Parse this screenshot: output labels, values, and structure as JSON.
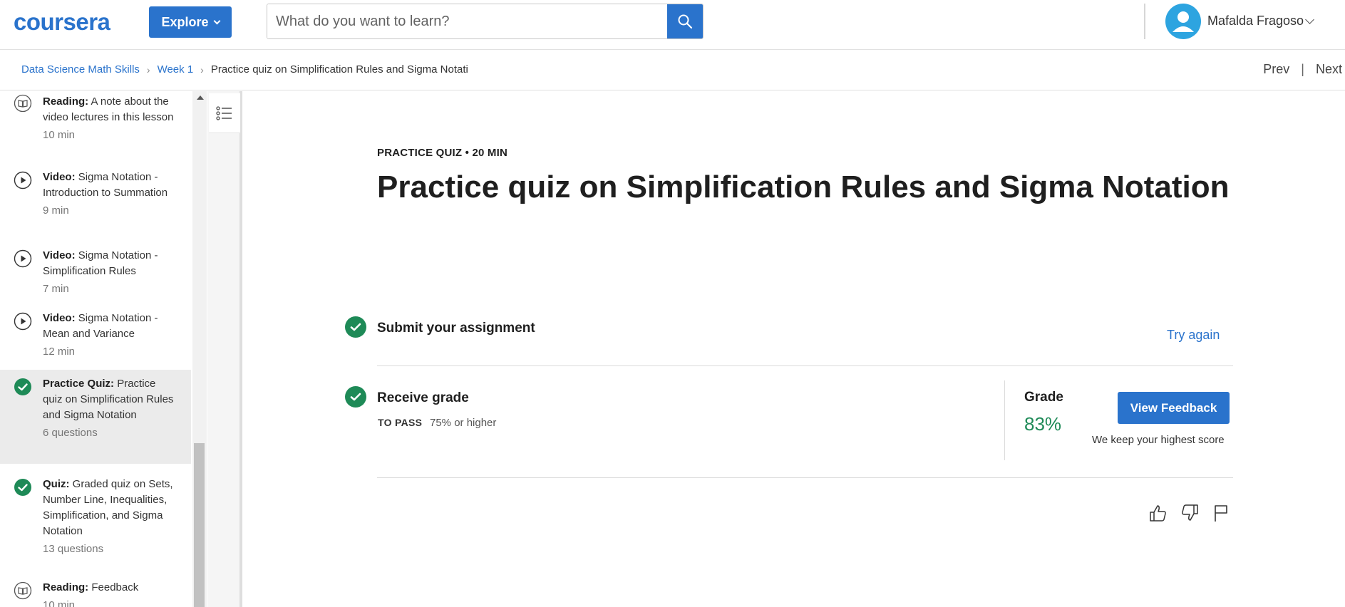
{
  "header": {
    "logo": "coursera",
    "explore_label": "Explore",
    "search_placeholder": "What do you want to learn?",
    "user_name": "Mafalda Fragoso"
  },
  "breadcrumb": {
    "items": [
      "Data Science Math Skills",
      "Week 1"
    ],
    "current": "Practice quiz on Simplification Rules and Sigma Notati",
    "prev": "Prev",
    "divider": "|",
    "next": "Next"
  },
  "sidebar": {
    "items": [
      {
        "type": "Reading:",
        "title": "A note about the video lectures in this lesson",
        "meta": "10 min",
        "icon": "book-icon"
      },
      {
        "type": "Video:",
        "title": "Sigma Notation - Introduction to Summation",
        "meta": "9 min",
        "icon": "play-icon"
      },
      {
        "type": "Video:",
        "title": "Sigma Notation - Simplification Rules",
        "meta": "7 min",
        "icon": "play-icon"
      },
      {
        "type": "Video:",
        "title": "Sigma Notation - Mean and Variance",
        "meta": "12 min",
        "icon": "play-icon"
      },
      {
        "type": "Practice Quiz:",
        "title": "Practice quiz on Simplification Rules and Sigma Notation",
        "meta": "6 questions",
        "icon": "check-circle-icon",
        "active": true
      },
      {
        "type": "Quiz:",
        "title": "Graded quiz on Sets, Number Line, Inequalities, Simplification, and Sigma Notation",
        "meta": "13 questions",
        "icon": "check-circle-icon"
      },
      {
        "type": "Reading:",
        "title": "Feedback",
        "meta": "10 min",
        "icon": "book-icon"
      }
    ]
  },
  "main": {
    "kicker": "PRACTICE QUIZ • 20 MIN",
    "title": "Practice quiz on Simplification Rules and Sigma Notation",
    "submit": {
      "title": "Submit your assignment",
      "action": "Try again"
    },
    "receive": {
      "title": "Receive grade",
      "pass_label": "TO PASS",
      "pass_value": "75% or higher",
      "grade_label": "Grade",
      "grade_value": "83%",
      "button": "View Feedback",
      "note": "We keep your highest score"
    }
  },
  "colors": {
    "brand_blue": "#2a73cc",
    "success_green": "#1e8a57",
    "active_row": "#ebebeb"
  }
}
